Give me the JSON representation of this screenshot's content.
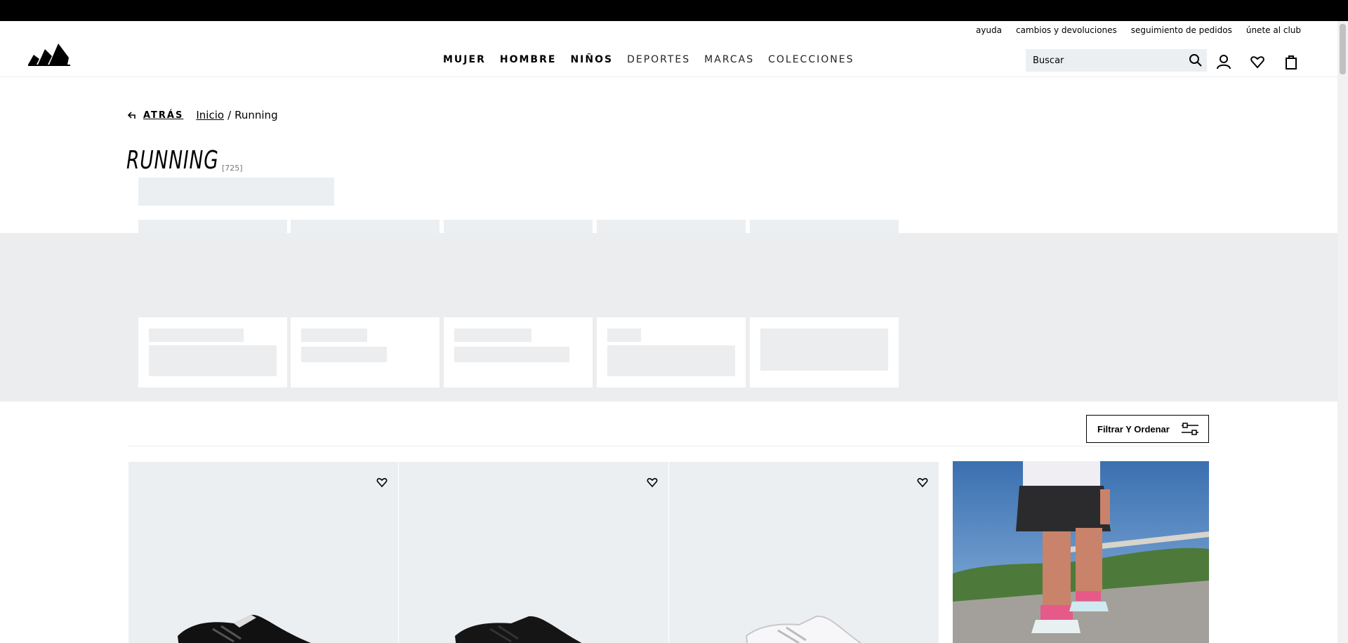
{
  "header": {
    "utility_links": [
      "ayuda",
      "cambios y devoluciones",
      "seguimiento de pedidos",
      "únete al club"
    ],
    "nav": [
      {
        "label": "MUJER",
        "weight": "bold"
      },
      {
        "label": "HOMBRE",
        "weight": "bold"
      },
      {
        "label": "NIÑOS",
        "weight": "bold"
      },
      {
        "label": "DEPORTES",
        "weight": "light"
      },
      {
        "label": "MARCAS",
        "weight": "light"
      },
      {
        "label": "COLECCIONES",
        "weight": "light"
      }
    ],
    "search_placeholder": "Buscar",
    "icons": [
      "search-icon",
      "account-icon",
      "wishlist-icon",
      "bag-icon"
    ]
  },
  "breadcrumb": {
    "back_label": "ATRÁS",
    "home": "Inicio",
    "separator": "/",
    "current": "Running"
  },
  "page": {
    "title": "RUNNING",
    "count": "[725]"
  },
  "filter": {
    "label": "Filtrar Y Ordenar"
  },
  "products": [
    {
      "colorway": "black",
      "fav_icon": "heart-icon"
    },
    {
      "colorway": "black",
      "fav_icon": "heart-icon"
    },
    {
      "colorway": "white",
      "fav_icon": "heart-icon"
    }
  ],
  "colors": {
    "skeleton": "#eceff1",
    "black": "#000000",
    "white": "#ffffff"
  }
}
